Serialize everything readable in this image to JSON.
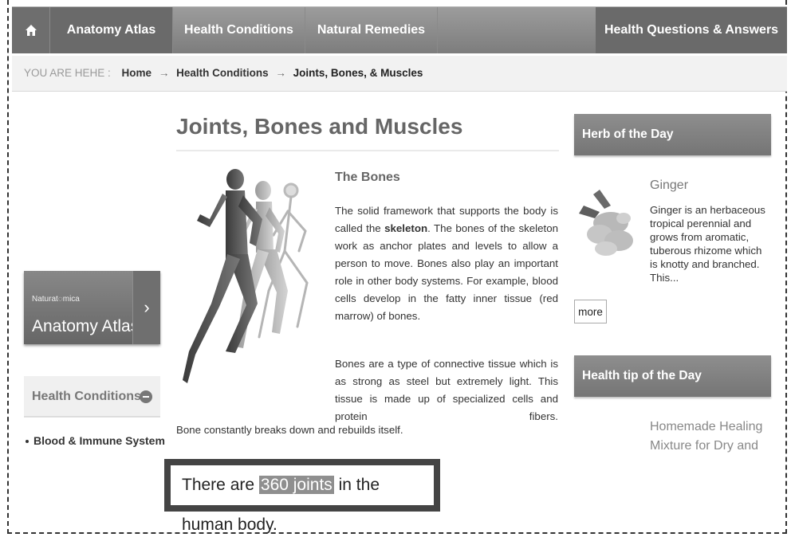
{
  "nav": {
    "home_icon": "home-icon",
    "items": [
      "Anatomy Atlas",
      "Health Conditions",
      "Natural Remedies"
    ],
    "right_item": "Health Questions & Answers"
  },
  "breadcrumb": {
    "label": "YOU ARE HEHE :",
    "home": "Home",
    "sep": "→",
    "section": "Health Conditions",
    "current": "Joints, Bones, & Muscles"
  },
  "left": {
    "atlas_brand": "Naturat◌mica",
    "atlas_title": "Anatomy Atlas",
    "atlas_arrow": "›",
    "health_conditions": "Health Conditions",
    "list_item": "Blood & Immune System"
  },
  "main": {
    "title": "Joints, Bones and Muscles",
    "section_heading": "The Bones",
    "p1_before": "The solid framework that supports the body is called the ",
    "p1_bold": "skeleton",
    "p1_after": ". The bones of the skeleton work as anchor plates and levels to allow a person to move. Bones also play an important role in other body systems. For example, blood cells develop in the fatty inner tissue (red marrow) of bones.",
    "p2": "Bones are a type of connective tissue which is as strong as steel but extremely light. This tissue is made up of specialized cells and protein fibers.",
    "p2_cont": "Bone constantly breaks down and rebuilds itself.",
    "callout_before": "There are ",
    "callout_highlight": "360 joints",
    "callout_after": " in the human body."
  },
  "right": {
    "herb_header": "Herb of the Day",
    "herb_name": "Ginger",
    "herb_desc": "Ginger is an herbaceous tropical perennial and grows from aromatic, tuberous rhizome which is knotty and branched. This...",
    "more": "more",
    "tip_header": "Health tip of the Day",
    "tip_text": "Homemade Healing Mixture for Dry and"
  }
}
